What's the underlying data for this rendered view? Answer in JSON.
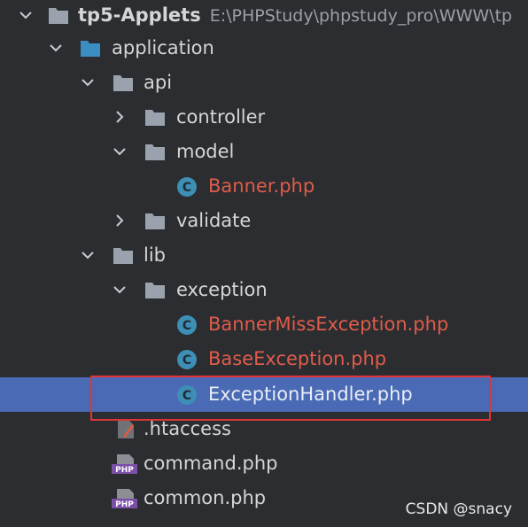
{
  "project": {
    "name": "tp5-Applets",
    "path": "E:\\PHPStudy\\phpstudy_pro\\WWW\\tp"
  },
  "tree": {
    "application": "application",
    "api": "api",
    "controller": "controller",
    "model": "model",
    "banner_php": "Banner.php",
    "validate": "validate",
    "lib": "lib",
    "exception": "exception",
    "banner_miss_exception": "BannerMissException.php",
    "base_exception": "BaseException.php",
    "exception_handler": "ExceptionHandler.php",
    "htaccess": ".htaccess",
    "command_php": "command.php",
    "common_php": "common.php"
  },
  "icons": {
    "folder": "folder-icon",
    "class": "php-class-icon",
    "php": "php-file-icon",
    "htaccess": "htaccess-file-icon"
  },
  "colors": {
    "background": "#2b2d30",
    "selection": "#4a6ab5",
    "modified_file": "#e05c4b",
    "highlight_box": "#e23434"
  },
  "watermark": "CSDN @snacy"
}
